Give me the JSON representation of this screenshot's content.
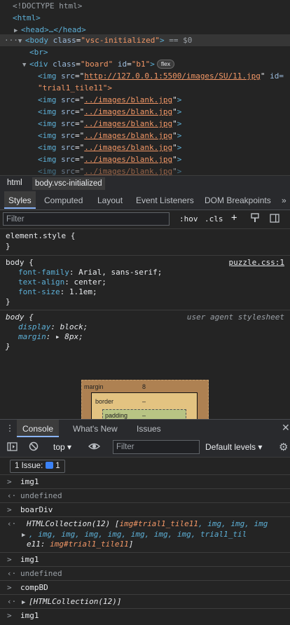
{
  "elements": {
    "doctype": "<!DOCTYPE html>",
    "html_open": "<html>",
    "head": "<head>…</head>",
    "body_tag": "body",
    "body_attr": "class",
    "body_value": "\"vsc-initialized\"",
    "body_eq": "== $0",
    "br": "<br>",
    "div_tag": "div",
    "div_attr1": "class",
    "div_val1": "\"board\"",
    "div_attr2": "id",
    "div_val2": "\"b1\"",
    "flex_badge": "flex",
    "img_first_src": "http://127.0.0.1:5500/images/SU/11.jpg",
    "img_first_id_attr": "id=",
    "img_first_id": "\"trial1_tile11\">",
    "img_blank_src": "../images/blank.jpg"
  },
  "breadcrumbs": [
    "html",
    "body.vsc-initialized"
  ],
  "styles_tabs": [
    "Styles",
    "Computed",
    "Layout",
    "Event Listeners",
    "DOM Breakpoints"
  ],
  "styles_more": "»",
  "filter": {
    "placeholder": "Filter",
    "hov": ":hov",
    "cls": ".cls",
    "plus": "+"
  },
  "rules": {
    "element_style": "element.style {",
    "close": "}",
    "body1_selector": "body {",
    "body1_source": "puzzle.css:1",
    "body1_props": [
      {
        "name": "font-family",
        "value": "Arial, sans-serif;"
      },
      {
        "name": "text-align",
        "value": "center;"
      },
      {
        "name": "font-size",
        "value": "1.1em;"
      }
    ],
    "body2_selector": "body {",
    "body2_source": "user agent stylesheet",
    "body2_props": [
      {
        "name": "display",
        "value": "block;"
      },
      {
        "name": "margin",
        "value": "▸ 8px;"
      }
    ]
  },
  "boxmodel": {
    "margin": "margin",
    "margin_val": "8",
    "border": "border",
    "border_val": "–",
    "padding": "padding",
    "padding_val": "–"
  },
  "console_tabs": [
    "Console",
    "What's New",
    "Issues"
  ],
  "console_toolbar": {
    "context": "top ▾",
    "filter_placeholder": "Filter",
    "levels": "Default levels ▾"
  },
  "issues": {
    "label": "1 Issue:",
    "count": "1"
  },
  "console": {
    "input1": "img1",
    "out1": "undefined",
    "input2": "boarDiv",
    "coll_head": "HTMLCollection(12) [",
    "coll_first": "img#trial1_tile11",
    "coll_rest1": ", img, img, img",
    "coll_line2": ", img, img, img, img, img, img, img, trial1_til",
    "coll_line3a": "e11: ",
    "coll_line3b": "img#trial1_tile11",
    "coll_line3c": "]",
    "input3": "img1",
    "out3": "undefined",
    "input4": "compBD",
    "out4": "[HTMLCollection(12)]",
    "input5": "img1"
  }
}
